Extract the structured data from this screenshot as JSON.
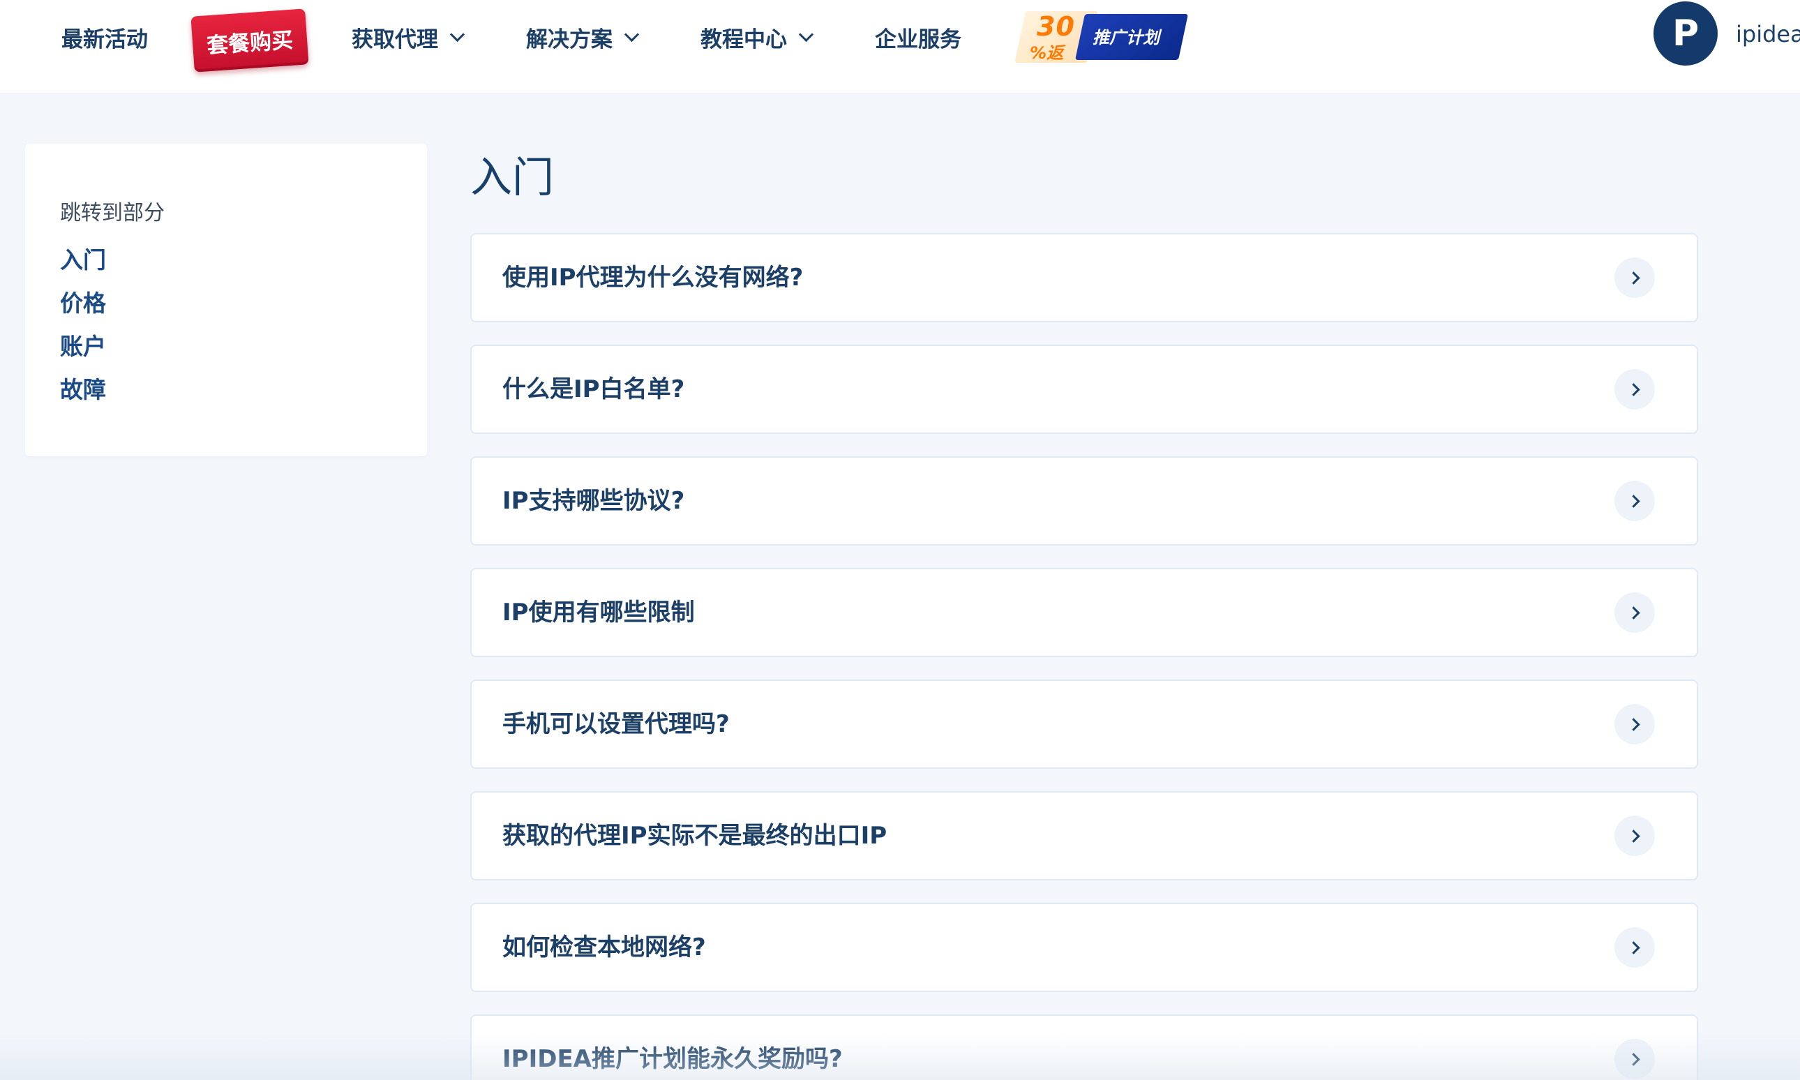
{
  "header": {
    "nav": [
      {
        "label": "最新活动",
        "has_dropdown": false
      },
      {
        "label": "套餐购买",
        "badge": true
      },
      {
        "label": "获取代理",
        "has_dropdown": true
      },
      {
        "label": "解决方案",
        "has_dropdown": true
      },
      {
        "label": "教程中心",
        "has_dropdown": true
      },
      {
        "label": "企业服务",
        "has_dropdown": false
      }
    ],
    "promo": {
      "percent": "30",
      "percent_sign": "%",
      "return_label": "返",
      "plan_label": "推广计划"
    },
    "brand": {
      "logo_letter": "P",
      "name": "ipidea"
    }
  },
  "sidebar": {
    "title": "跳转到部分",
    "links": [
      "入门",
      "价格",
      "账户",
      "故障"
    ]
  },
  "main": {
    "title": "入门",
    "faq": [
      "使用IP代理为什么没有网络?",
      "什么是IP白名单?",
      "IP支持哪些协议?",
      "IP使用有哪些限制",
      "手机可以设置代理吗?",
      "获取的代理IP实际不是最终的出口IP",
      "如何检查本地网络?",
      "IPIDEA推广计划能永久奖励吗?"
    ]
  },
  "colors": {
    "background": "#f3f7fc",
    "text_primary": "#1b3f66",
    "link": "#1a4b86",
    "buy_badge": "#d6182f",
    "brand_logo": "#143a6b"
  },
  "icons": [
    "chevron-down-icon",
    "chevron-right-icon",
    "brand-logo"
  ]
}
